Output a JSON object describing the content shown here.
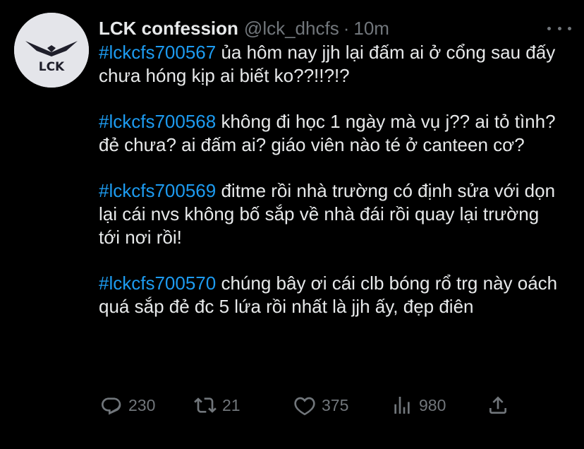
{
  "author": {
    "display_name": "LCK confession",
    "handle": "@lck_dhcfs",
    "separator": "·",
    "time": "10m",
    "avatar_text": "LCK"
  },
  "posts": [
    {
      "hashtag": "#lckcfs700567",
      "text": " ủa hôm nay jjh lại đấm ai ở cổng sau đấy chưa hóng kịp ai biết ko??!!?!?"
    },
    {
      "hashtag": "#lckcfs700568",
      "text": " không đi học 1 ngày mà vụ j?? ai tỏ tình? đẻ chưa? ai đấm ai? giáo viên nào té ở canteen cơ?"
    },
    {
      "hashtag": "#lckcfs700569",
      "text": " đitme rồi nhà trường có định sửa với dọn lại cái nvs không bố sắp về nhà đái rồi quay lại trường tới nơi rồi!"
    },
    {
      "hashtag": "#lckcfs700570",
      "text": " chúng bây ơi cái clb bóng rổ trg này oách quá sắp đẻ đc 5 lứa rồi nhất là jjh ấy, đẹp điên"
    }
  ],
  "stats": {
    "replies": "230",
    "retweets": "21",
    "likes": "375",
    "views": "980"
  },
  "icons": {
    "reply": "reply-icon",
    "retweet": "retweet-icon",
    "like": "heart-icon",
    "views": "views-icon",
    "share": "share-icon",
    "more": "more-icon"
  },
  "colors": {
    "background": "#000000",
    "text": "#e7e9ea",
    "secondary": "#71767b",
    "link": "#1d9bf0"
  }
}
